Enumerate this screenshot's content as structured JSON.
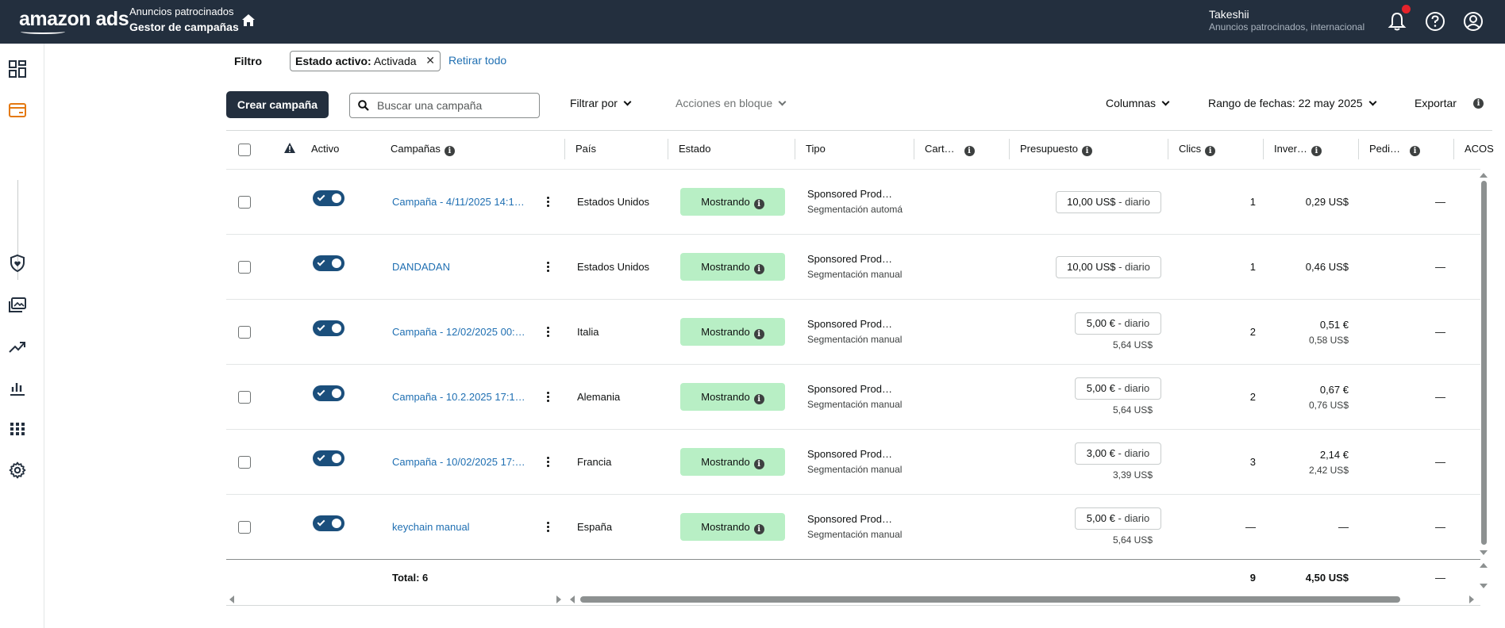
{
  "topbar": {
    "logo": "amazon ads",
    "product_title": "Anuncios patrocinados",
    "product_subtitle": "Gestor de campañas",
    "account_name": "Takeshii",
    "account_sub": "Anuncios patrocinados, internacional"
  },
  "filter": {
    "label": "Filtro",
    "chip_key": "Estado activo:",
    "chip_value": "Activada",
    "clear_all": "Retirar todo"
  },
  "toolbar": {
    "create_label": "Crear campaña",
    "search_placeholder": "Buscar una campaña",
    "filter_by": "Filtrar por",
    "bulk_actions": "Acciones en bloque",
    "columns": "Columnas",
    "date_range": "Rango de fechas: 22 may 2025",
    "export": "Exportar"
  },
  "table": {
    "headers": {
      "active": "Activo",
      "campaigns": "Campañas",
      "country": "País",
      "status": "Estado",
      "type": "Tipo",
      "portfolio": "Cart…",
      "budget": "Presupuesto",
      "clicks": "Clics",
      "spend": "Inver…",
      "orders": "Pedi…",
      "acos": "ACOS"
    },
    "rows": [
      {
        "name": "Campaña - 4/11/2025 14:1…",
        "country": "Estados Unidos",
        "status": "Mostrando",
        "type": "Sponsored Prod…",
        "targeting": "Segmentación automá",
        "budget": "10,00 US$",
        "budget_suffix": " - diario",
        "budget_sub": "",
        "clicks": "1",
        "spend": "0,29 US$",
        "spend_sub": "",
        "orders": "—"
      },
      {
        "name": "DANDADAN",
        "country": "Estados Unidos",
        "status": "Mostrando",
        "type": "Sponsored Prod…",
        "targeting": "Segmentación manual",
        "budget": "10,00 US$",
        "budget_suffix": " - diario",
        "budget_sub": "",
        "clicks": "1",
        "spend": "0,46 US$",
        "spend_sub": "",
        "orders": "—"
      },
      {
        "name": "Campaña - 12/02/2025 00:…",
        "country": "Italia",
        "status": "Mostrando",
        "type": "Sponsored Prod…",
        "targeting": "Segmentación manual",
        "budget": "5,00 €",
        "budget_suffix": " - diario",
        "budget_sub": "5,64 US$",
        "clicks": "2",
        "spend": "0,51 €",
        "spend_sub": "0,58 US$",
        "orders": "—"
      },
      {
        "name": "Campaña - 10.2.2025 17:1…",
        "country": "Alemania",
        "status": "Mostrando",
        "type": "Sponsored Prod…",
        "targeting": "Segmentación manual",
        "budget": "5,00 €",
        "budget_suffix": " - diario",
        "budget_sub": "5,64 US$",
        "clicks": "2",
        "spend": "0,67 €",
        "spend_sub": "0,76 US$",
        "orders": "—"
      },
      {
        "name": "Campaña - 10/02/2025 17:…",
        "country": "Francia",
        "status": "Mostrando",
        "type": "Sponsored Prod…",
        "targeting": "Segmentación manual",
        "budget": "3,00 €",
        "budget_suffix": " - diario",
        "budget_sub": "3,39 US$",
        "clicks": "3",
        "spend": "2,14 €",
        "spend_sub": "2,42 US$",
        "orders": "—"
      },
      {
        "name": "keychain manual",
        "country": "España",
        "status": "Mostrando",
        "type": "Sponsored Prod…",
        "targeting": "Segmentación manual",
        "budget": "5,00 €",
        "budget_suffix": " - diario",
        "budget_sub": "5,64 US$",
        "clicks": "—",
        "spend": "—",
        "spend_sub": "",
        "orders": "—"
      }
    ],
    "total": {
      "label": "Total: 6",
      "clicks": "9",
      "spend": "4,50 US$",
      "orders": "—"
    }
  },
  "colors": {
    "topbar": "#232f3e",
    "link": "#1f6fb2",
    "status_green": "#b8efc5",
    "toggle": "#1b4f7c",
    "accent_orange": "#e47911"
  }
}
